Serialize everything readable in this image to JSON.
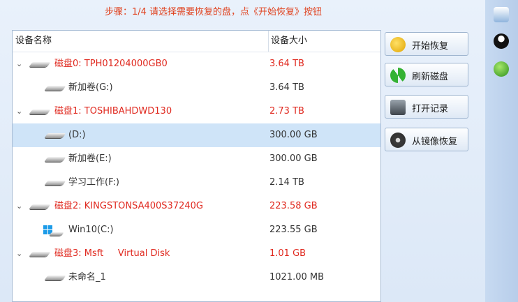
{
  "step_text": "步骤：1/4 请选择需要恢复的盘，点《开始恢复》按钮",
  "table": {
    "col_name": "设备名称",
    "col_size": "设备大小"
  },
  "rows": [
    {
      "name": "磁盘0: TPH01204000GB0",
      "size": "3.64 TB"
    },
    {
      "name": "新加卷(G:)",
      "size": "3.64 TB"
    },
    {
      "name": "磁盘1: TOSHIBAHDWD130",
      "size": "2.73 TB"
    },
    {
      "name": "(D:)",
      "size": "300.00 GB"
    },
    {
      "name": "新加卷(E:)",
      "size": "300.00 GB"
    },
    {
      "name": "学习工作(F:)",
      "size": "2.14 TB"
    },
    {
      "name": "磁盘2: KINGSTONSA400S37240G",
      "size": "223.58 GB"
    },
    {
      "name": "Win10(C:)",
      "size": "223.55 GB"
    },
    {
      "name": "磁盘3: Msft     Virtual Disk",
      "size": "1.01 GB"
    },
    {
      "name": "未命名_1",
      "size": "1021.00 MB"
    }
  ],
  "buttons": {
    "start": "开始恢复",
    "refresh": "刷新磁盘",
    "open_record": "打开记录",
    "from_image": "从镜像恢复"
  },
  "colors": {
    "accent_red": "#e0291f",
    "selected_row": "#cfe4f8"
  },
  "icons": {
    "start": "search-recover-icon",
    "refresh": "refresh-icon",
    "open_record": "camera-record-icon",
    "from_image": "disk-image-icon",
    "right_1": "disk-cloud-icon",
    "right_2": "qq-penguin-icon",
    "right_3": "help-icon"
  }
}
